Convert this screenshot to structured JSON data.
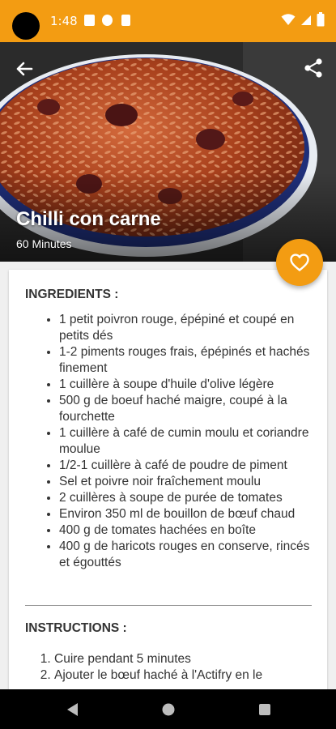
{
  "status_bar": {
    "time": "1:48"
  },
  "recipe": {
    "title": "Chilli con carne",
    "duration": "60 Minutes",
    "ingredients_header": "INGREDIENTS :",
    "ingredients": [
      "1 petit poivron rouge, épépiné et coupé en petits dés",
      "1-2 piments rouges frais, épépinés et hachés finement",
      "1 cuillère à soupe d'huile d'olive légère",
      "500 g de boeuf haché maigre, coupé à la fourchette",
      "1 cuillère à café de cumin moulu et coriandre moulue",
      "1/2-1 cuillère à café de poudre de piment",
      "Sel et poivre noir fraîchement moulu",
      "2 cuillères à soupe de purée de tomates",
      "Environ 350 ml de bouillon de bœuf chaud",
      "400 g de tomates hachées en boîte",
      "400 g de haricots rouges en conserve, rincés et égouttés"
    ],
    "instructions_header": "INSTRUCTIONS :",
    "instructions": [
      "Cuire pendant 5 minutes",
      "Ajouter le bœuf haché à l'Actifry en le"
    ]
  },
  "icons": {
    "back": "arrow-back-icon",
    "share": "share-icon",
    "favorite": "heart-outline-icon",
    "nav_back": "triangle-back-icon",
    "nav_home": "circle-home-icon",
    "nav_recents": "square-recents-icon"
  },
  "colors": {
    "accent": "#f39c12",
    "text": "#333333",
    "card": "#ffffff",
    "background": "#f0f0f0"
  }
}
